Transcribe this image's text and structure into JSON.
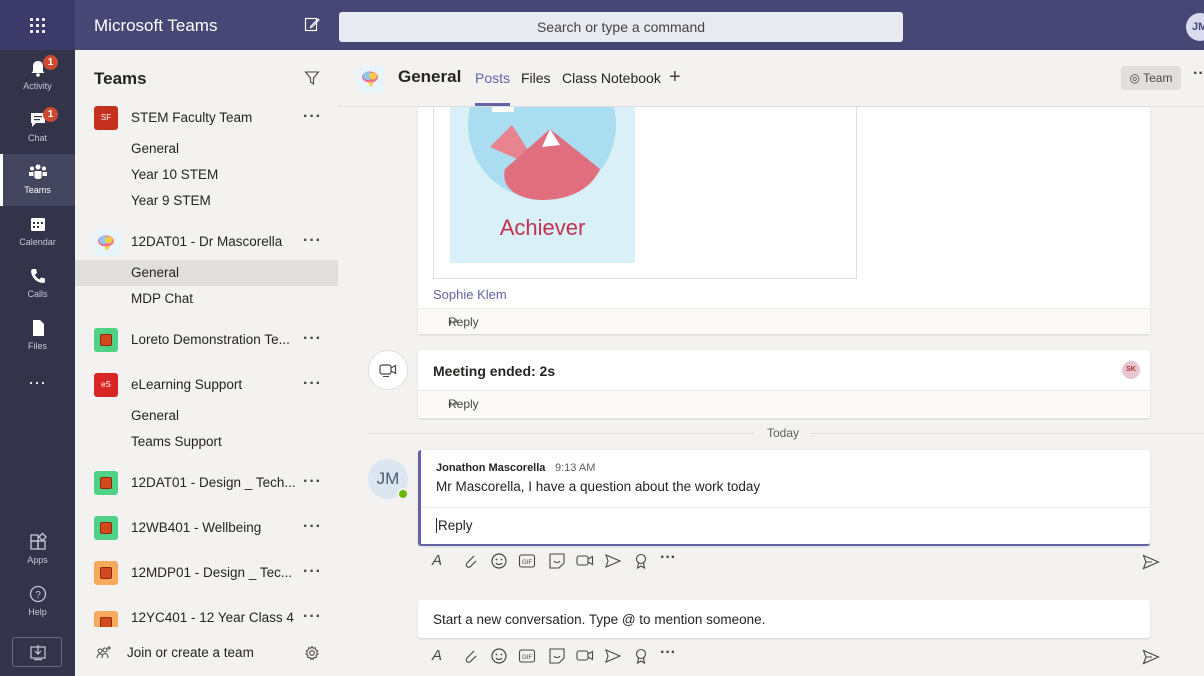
{
  "app": {
    "title": "Microsoft Teams",
    "avatar_initials": "JM"
  },
  "search": {
    "placeholder": "Search or type a command"
  },
  "rail": [
    {
      "label": "Activity",
      "badge": "1"
    },
    {
      "label": "Chat",
      "badge": "1"
    },
    {
      "label": "Teams"
    },
    {
      "label": "Calendar"
    },
    {
      "label": "Calls"
    },
    {
      "label": "Files"
    },
    {
      "label": "..."
    },
    {
      "label": "Apps"
    },
    {
      "label": "Help"
    }
  ],
  "panel": {
    "title": "Teams",
    "teams": [
      {
        "name": "STEM Faculty Team",
        "logo": "SF",
        "logo_color": "#c4311e",
        "channels": [
          "General",
          "Year 10 STEM",
          "Year 9 STEM"
        ]
      },
      {
        "name": "12DAT01 - Dr Mascorella",
        "channels": [
          "General",
          "MDP Chat"
        ]
      },
      {
        "name": "Loreto Demonstration Te...",
        "logo_color": "#4fd186",
        "channels": []
      },
      {
        "name": "eLearning Support",
        "logo": "eS",
        "logo_color": "#d92525",
        "channels": [
          "General",
          "Teams Support"
        ]
      },
      {
        "name": "12DAT01 - Design _ Tech...",
        "logo_color": "#4fd186",
        "channels": []
      },
      {
        "name": "12WB401 - Wellbeing",
        "logo_color": "#4fd186",
        "channels": []
      },
      {
        "name": "12MDP01 - Design _ Tec...",
        "logo_color": "#f7a95c",
        "channels": []
      },
      {
        "name": "12YC401 - 12 Year Class 4",
        "logo_color": "#f7a95c",
        "channels": []
      }
    ],
    "join_label": "Join or create a team"
  },
  "channel": {
    "name": "General",
    "tabs": [
      "Posts",
      "Files",
      "Class Notebook"
    ],
    "team_button": "Team"
  },
  "feed": {
    "badge_text": "Achiever",
    "badge_sender": "Sophie Klem",
    "reply_label": "Reply",
    "meeting_title": "Meeting ended: 2s",
    "meeting_badge": "SK",
    "today_label": "Today",
    "message": {
      "avatar": "JM",
      "author": "Jonathon Mascorella",
      "time": "9:13 AM",
      "body": "Mr Mascorella, I have a question about the work today"
    },
    "reply_input_value": "Reply",
    "new_conversation_placeholder": "Start a new conversation. Type @ to mention someone."
  },
  "colors": {
    "brand": "#464775",
    "accent": "#6264a7",
    "rail": "#33344a"
  }
}
